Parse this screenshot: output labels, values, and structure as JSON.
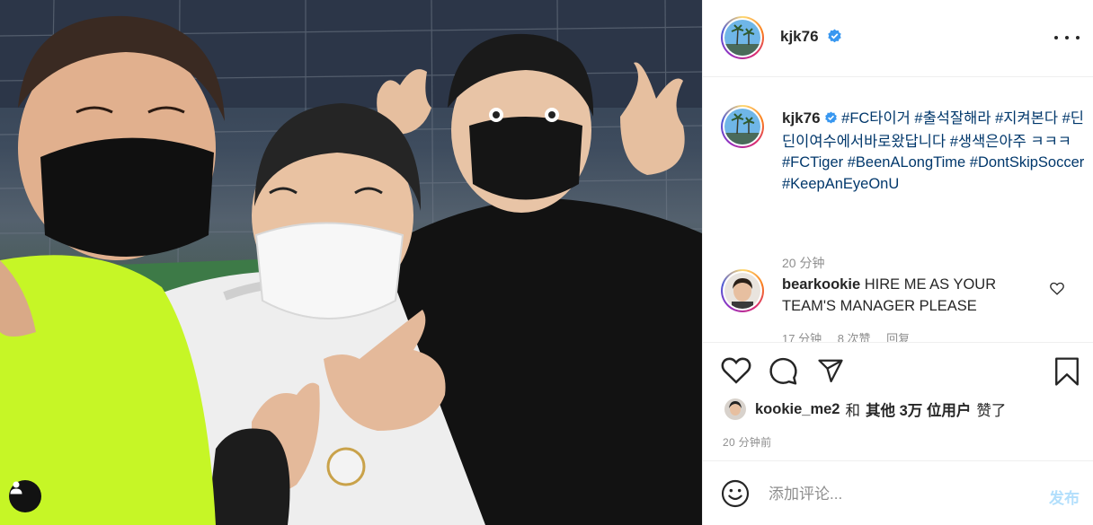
{
  "post": {
    "author": "kjk76",
    "verified": true,
    "more_icon": "more-horizontal-icon"
  },
  "caption": {
    "username": "kjk76",
    "text": "#FC타이거 #출석잘해라 #지켜본다 #딘딘이여수에서바로왔답니다 #생색은아주 ㅋㅋㅋ #FCTiger #BeenALongTime #DontSkipSoccer #KeepAnEyeOnU",
    "time": "20 分钟"
  },
  "comment": {
    "username": "bearkookie",
    "text": "HIRE ME AS YOUR TEAM'S MANAGER PLEASE",
    "meta": {
      "time": "17 分钟",
      "likes": "8 次赞",
      "reply": "回复"
    }
  },
  "actions": {
    "like_icon": "heart-icon",
    "comment_icon": "comment-icon",
    "share_icon": "send-icon",
    "save_icon": "bookmark-icon"
  },
  "likes": {
    "liker": "kookie_me2",
    "and": "和",
    "others": "其他",
    "count": "3万",
    "users": "位用户",
    "suffix": "赞了"
  },
  "post_time": "20 分钟前",
  "composer": {
    "placeholder": "添加评论...",
    "post_label": "发布"
  },
  "colors": {
    "link": "#00376b",
    "verified": "#3897f0",
    "secondary_text": "#8e8e8e",
    "post_button_disabled": "#b2dffc",
    "divider": "#efefef"
  }
}
